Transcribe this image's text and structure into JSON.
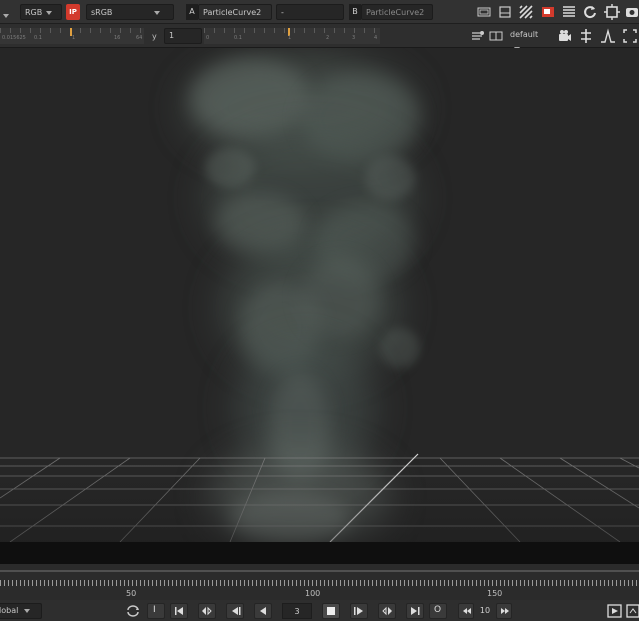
{
  "toolbar": {
    "channels_value": "RGB",
    "ip_label": "IP",
    "colorspace_value": "sRGB",
    "input_a_tag": "A",
    "input_a_value": "ParticleCurve2",
    "compositing_value": "-",
    "input_b_tag": "B",
    "input_b_value": "ParticleCurve2"
  },
  "subbar": {
    "gain_value_label": "0.015625",
    "gain_ticks": [
      "0.1",
      "1",
      "16",
      "64"
    ],
    "gamma_prefix": "y",
    "gamma_value": "1",
    "gamma_ticks": [
      "0",
      "0.1",
      "1",
      "2",
      "3",
      "4"
    ],
    "viewer_mode_value": "default"
  },
  "timeline": {
    "labels": [
      "50",
      "100",
      "150"
    ],
    "global_label": "lobal"
  },
  "transport": {
    "in_label": "I",
    "out_label": "O",
    "frame_value": "3",
    "skip_value": "10"
  },
  "colors": {
    "accent_orange": "#e0a040",
    "ip_red": "#d33a2c",
    "active_red": "#d33a2c"
  }
}
